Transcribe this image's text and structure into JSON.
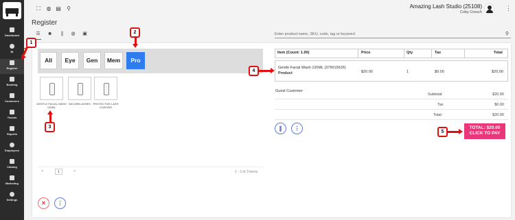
{
  "sidebar": {
    "items": [
      {
        "label": "Dashboard",
        "icon": "grid-icon"
      },
      {
        "label": "BI",
        "icon": "bulb-icon"
      },
      {
        "label": "Register",
        "icon": "cart-icon",
        "active": true
      },
      {
        "label": "Booking",
        "icon": "calendar-icon"
      },
      {
        "label": "Customers",
        "icon": "people-icon"
      },
      {
        "label": "Tickets",
        "icon": "ticket-icon"
      },
      {
        "label": "Reports",
        "icon": "chart-icon"
      },
      {
        "label": "Employees",
        "icon": "person-icon"
      },
      {
        "label": "Catalog",
        "icon": "list-icon"
      },
      {
        "label": "Marketing",
        "icon": "tag-icon"
      },
      {
        "label": "Settings",
        "icon": "gear-icon"
      }
    ]
  },
  "header": {
    "store_name": "Amazing Lash Studio (25108)",
    "user_name": "Coby Crouch"
  },
  "page": {
    "title": "Register",
    "search_placeholder": "Enter product name, SKU, code, tag or keyword"
  },
  "categories": [
    {
      "label": "All"
    },
    {
      "label": "Eye"
    },
    {
      "label": "Gen"
    },
    {
      "label": "Mem"
    },
    {
      "label": "Pro",
      "selected": true
    }
  ],
  "products": [
    {
      "label": "GENTLE FACIAL WASH 120ML"
    },
    {
      "label": "NATURELASHES"
    },
    {
      "label": "PROTECTIVE LASH COATING"
    }
  ],
  "pagination": {
    "prev": "«",
    "page": "1",
    "next": "»",
    "info": "1 - 3 of 3 items"
  },
  "cart": {
    "columns": {
      "item": "Item (Count: 1.00)",
      "price": "Price",
      "qty": "Qty",
      "tax": "Tax",
      "total": "Total"
    },
    "rows": [
      {
        "name": "Gentle Facial Wash 120ML (379615626)",
        "type": "Product",
        "price": "$20.00",
        "qty": "1",
        "tax": "$0.00",
        "total": "$20.00"
      }
    ],
    "customer": "Guest Customer",
    "subtotal_label": "Subtotal:",
    "subtotal": "$20.00",
    "tax_label": "Tax",
    "tax": "$0.00",
    "total_label": "Total:",
    "total": "$20.00",
    "pay_line1": "TOTAL: $20.00",
    "pay_line2": "CLICK TO PAY"
  },
  "annotations": [
    "1",
    "2",
    "3",
    "4",
    "5"
  ],
  "colors": {
    "sidebar": "#2b2b2b",
    "accent_blue": "#2f7bf0",
    "pay_pink": "#e8387a",
    "annotation_red": "#dd1111"
  }
}
